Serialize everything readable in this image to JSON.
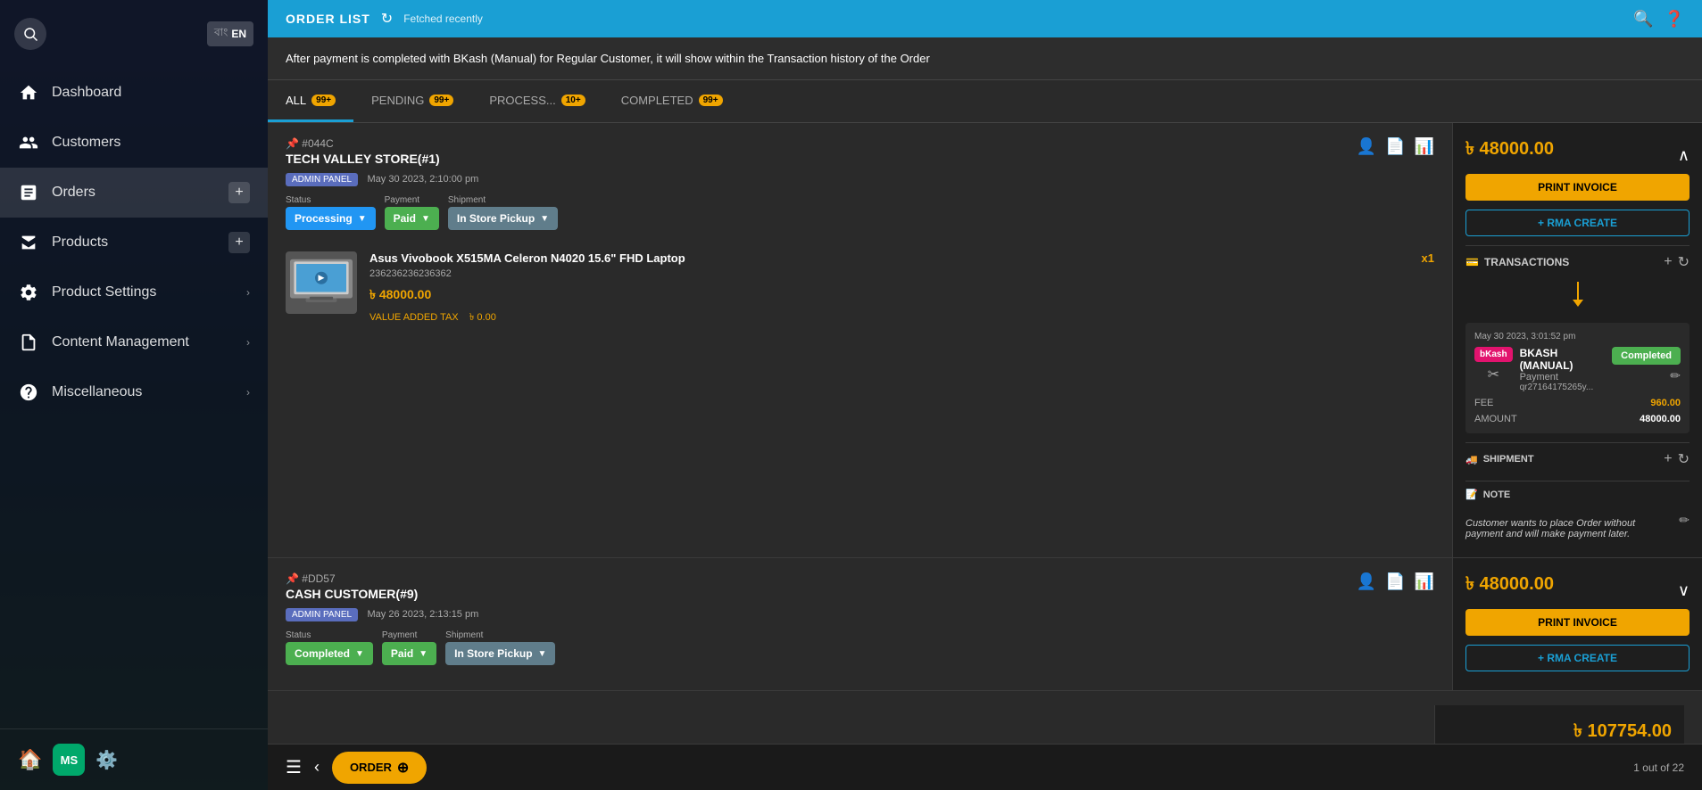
{
  "sidebar": {
    "lang": {
      "active": "EN",
      "inactive": "বাং"
    },
    "nav": [
      {
        "id": "dashboard",
        "label": "Dashboard",
        "icon": "home"
      },
      {
        "id": "customers",
        "label": "Customers",
        "icon": "people"
      },
      {
        "id": "orders",
        "label": "Orders",
        "icon": "list",
        "hasPlus": true
      },
      {
        "id": "products",
        "label": "Products",
        "icon": "box",
        "hasPlus": true
      },
      {
        "id": "product-settings",
        "label": "Product Settings",
        "icon": "settings",
        "hasArrow": true
      },
      {
        "id": "content-management",
        "label": "Content Management",
        "icon": "file",
        "hasArrow": true
      },
      {
        "id": "miscellaneous",
        "label": "Miscellaneous",
        "icon": "misc",
        "hasArrow": true
      }
    ],
    "footer": {
      "avatar_text": "MS"
    }
  },
  "topbar": {
    "title": "ORDER LIST",
    "fetched_label": "Fetched recently"
  },
  "tooltip": {
    "text": "After payment is completed with BKash (Manual) for Regular Customer, it will show within the Transaction history of the Order"
  },
  "tabs": [
    {
      "id": "all",
      "label": "ALL",
      "badge": "99+",
      "active": true
    },
    {
      "id": "pending",
      "label": "PENDING",
      "badge": "99+"
    },
    {
      "id": "processing",
      "label": "PROCESS...",
      "badge": "10+"
    },
    {
      "id": "completed",
      "label": "COMPLETED",
      "badge": "99+"
    }
  ],
  "order1": {
    "id": "#044C",
    "name": "TECH VALLEY STORE(#1)",
    "source": "ADMIN PANEL",
    "date": "May 30 2023, 2:10:00 pm",
    "status": "Processing",
    "payment": "Paid",
    "shipment": "In Store Pickup",
    "total": "৳ 48000.00",
    "print_invoice": "PRINT INVOICE",
    "rma_create": "+ RMA CREATE",
    "product": {
      "name": "Asus Vivobook X515MA Celeron N4020 15.6\" FHD Laptop",
      "sku": "236236236236362",
      "price": "৳ 48000.00",
      "tax_label": "VALUE ADDED TAX",
      "tax_value": "৳ 0.00",
      "qty": "x1"
    },
    "transactions": {
      "title": "TRANSACTIONS",
      "item": {
        "date": "May 30 2023, 3:01:52 pm",
        "method": "BKASH (MANUAL)",
        "type": "Payment",
        "ref": "qr27164175265y...",
        "status": "Completed",
        "fee_label": "FEE",
        "fee_value": "960.00",
        "amount_label": "AMOUNT",
        "amount_value": "48000.00"
      }
    },
    "shipment_label": "SHIPMENT",
    "note_label": "NOTE",
    "note_text": "Customer wants to place Order without payment and will make payment later."
  },
  "order2": {
    "id": "#DD57",
    "name": "CASH CUSTOMER(#9)",
    "source": "ADMIN PANEL",
    "date": "May 26 2023, 2:13:15 pm",
    "status": "Completed",
    "payment": "Paid",
    "shipment": "In Store Pickup",
    "total": "৳ 48000.00",
    "print_invoice": "PRINT INVOICE",
    "rma_create": "+ RMA CREATE"
  },
  "order3": {
    "total": "৳ 107754.00"
  },
  "bottom_bar": {
    "order_btn": "ORDER",
    "page_info": "1 out of 22"
  }
}
